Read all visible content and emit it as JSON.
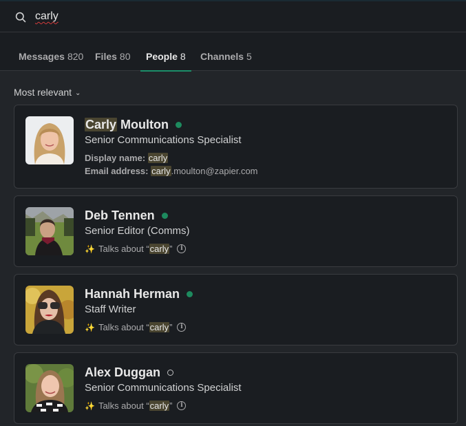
{
  "search": {
    "query": "carly",
    "icon": "search-icon"
  },
  "tabs": [
    {
      "label": "Messages",
      "count": "820",
      "active": false
    },
    {
      "label": "Files",
      "count": "80",
      "active": false
    },
    {
      "label": "People",
      "count": "8",
      "active": true
    },
    {
      "label": "Channels",
      "count": "5",
      "active": false
    }
  ],
  "sort": {
    "label": "Most relevant",
    "icon": "chevron-down-icon"
  },
  "accent_color": "#1c8f6a",
  "results": [
    {
      "name_highlight": "Carly",
      "name_rest": " Moulton",
      "status": "active",
      "title": "Senior Communications Specialist",
      "display_name_label": "Display name:",
      "display_name_value": "carly",
      "email_label": "Email address:",
      "email_highlight": "carly",
      "email_rest": ".moulton@zapier.com"
    },
    {
      "name": "Deb Tennen",
      "status": "active",
      "title": "Senior Editor (Comms)",
      "talks_prefix": "Talks about “",
      "talks_term": "carly",
      "talks_suffix": "”"
    },
    {
      "name": "Hannah Herman",
      "status": "active",
      "title": "Staff Writer",
      "talks_prefix": "Talks about “",
      "talks_term": "carly",
      "talks_suffix": "”"
    },
    {
      "name": "Alex Duggan",
      "status": "away",
      "title": "Senior Communications Specialist",
      "talks_prefix": "Talks about “",
      "talks_term": "carly",
      "talks_suffix": "”"
    }
  ]
}
